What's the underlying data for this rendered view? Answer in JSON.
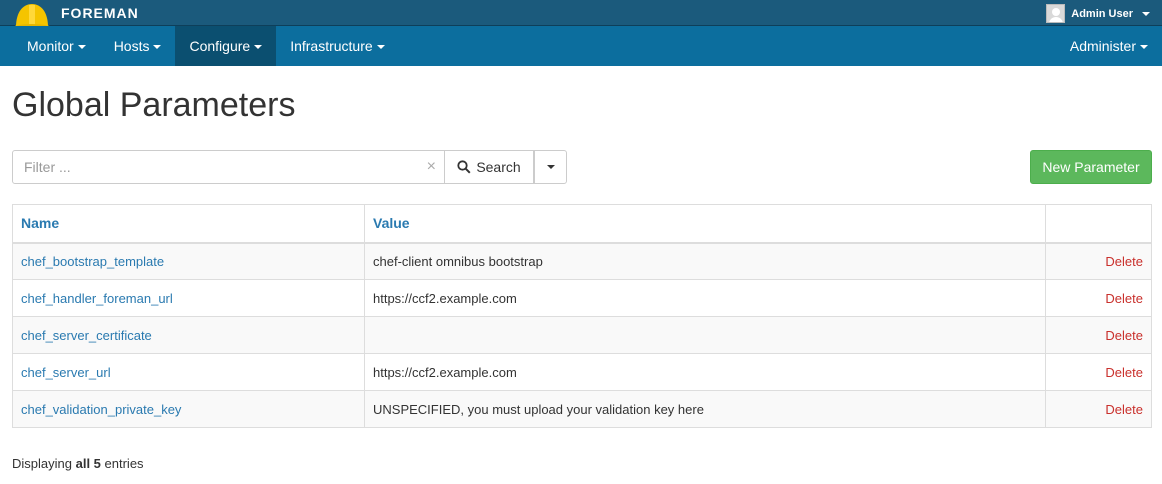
{
  "header": {
    "brand": "FOREMAN",
    "user": "Admin User"
  },
  "nav": {
    "items": [
      {
        "label": "Monitor"
      },
      {
        "label": "Hosts"
      },
      {
        "label": "Configure"
      },
      {
        "label": "Infrastructure"
      }
    ],
    "right": {
      "label": "Administer"
    }
  },
  "page": {
    "title": "Global Parameters"
  },
  "search": {
    "placeholder": "Filter ...",
    "clear": "×",
    "button": "Search"
  },
  "actions": {
    "new": "New Parameter"
  },
  "table": {
    "columns": [
      "Name",
      "Value",
      ""
    ],
    "rows": [
      {
        "name": "chef_bootstrap_template",
        "value": "chef-client omnibus bootstrap",
        "action": "Delete"
      },
      {
        "name": "chef_handler_foreman_url",
        "value": "https://ccf2.example.com",
        "action": "Delete"
      },
      {
        "name": "chef_server_certificate",
        "value": "",
        "action": "Delete"
      },
      {
        "name": "chef_server_url",
        "value": "https://ccf2.example.com",
        "action": "Delete"
      },
      {
        "name": "chef_validation_private_key",
        "value": "UNSPECIFIED, you must upload your validation key here",
        "action": "Delete"
      }
    ]
  },
  "footer": {
    "prefix": "Displaying",
    "count": "all 5",
    "suffix": "entries"
  },
  "colors": {
    "topbar": "#1b5a7c",
    "navbar": "#0c6e9e",
    "nav_active": "#0b4f70",
    "link": "#2a7ab0",
    "danger": "#c9302c",
    "success": "#5cb85c"
  }
}
